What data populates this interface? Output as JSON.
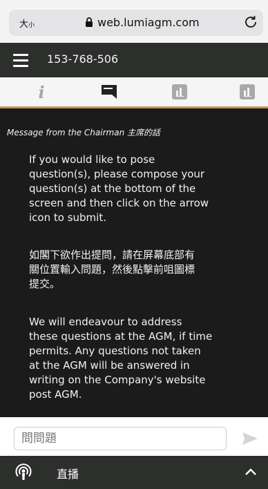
{
  "browser": {
    "text_size_label": "大",
    "text_size_small": "小",
    "url": "web.lumiagm.com",
    "icons": {
      "lock": "lock-icon",
      "reload": "reload-icon"
    }
  },
  "app": {
    "meeting_id": "153-768-506",
    "icons": {
      "menu": "hamburger-menu-icon"
    }
  },
  "tabs": [
    {
      "label": "i",
      "icon": "info-icon",
      "active": false
    },
    {
      "icon": "message-icon",
      "active": true
    },
    {
      "icon": "poll-chart-icon",
      "active": false
    },
    {
      "icon": "poll-chart-icon",
      "active": false
    }
  ],
  "message": {
    "header": "Message from the Chairman 主席的話",
    "paragraph_1": [
      "If you would like to pose",
      "question(s), please compose your",
      "question(s) at the bottom of the",
      "screen and then click on the arrow",
      "icon to submit."
    ],
    "paragraph_2": [
      "如閣下欲作出提問，請在屏幕底部有",
      "關位置輸入問題，然後點擊前咀圖標",
      "提交。"
    ],
    "paragraph_3": [
      "We will endeavour to address",
      "these questions at the AGM, if time",
      "permits.  Any questions not taken",
      "at the AGM will be answered in",
      "writing on the Company's website",
      "post AGM."
    ]
  },
  "question_input": {
    "placeholder": "問問題"
  },
  "live": {
    "label": "直播"
  },
  "colors": {
    "accent": "#c49a54",
    "header_bg": "#2d2f2d",
    "content_bg": "#1b1b1b"
  }
}
